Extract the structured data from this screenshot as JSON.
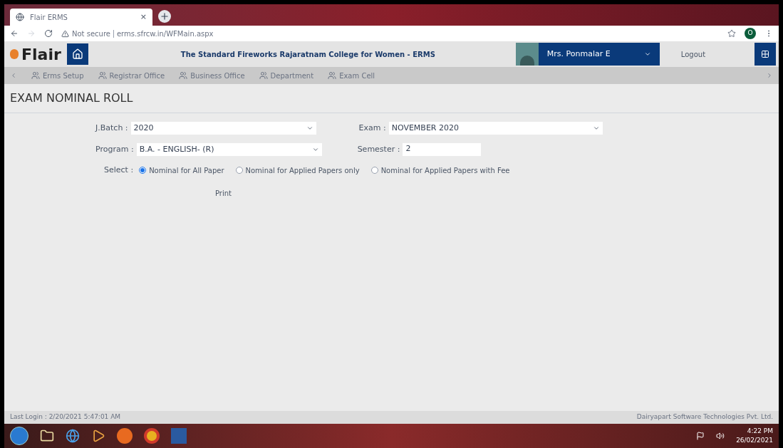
{
  "browser": {
    "tab_title": "Flair ERMS",
    "tab_close": "×",
    "address_warning": "Not secure",
    "url": "erms.sfrcw.in/WFMain.aspx",
    "profile_initial": "O"
  },
  "header": {
    "logo": "Flair",
    "college": "The Standard Fireworks Rajaratnam College for Women - ERMS",
    "user": "Mrs. Ponmalar E",
    "logout": "Logout"
  },
  "nav": [
    {
      "label": "Erms Setup"
    },
    {
      "label": "Registrar Office"
    },
    {
      "label": "Business Office"
    },
    {
      "label": "Department"
    },
    {
      "label": "Exam Cell"
    }
  ],
  "page_title": "EXAM NOMINAL ROLL",
  "form": {
    "batch": {
      "label": "J.Batch :",
      "value": "2020"
    },
    "exam": {
      "label": "Exam :",
      "value": "NOVEMBER 2020"
    },
    "program": {
      "label": "Program :",
      "value": "B.A. - ENGLISH- (R)"
    },
    "semester": {
      "label": "Semester :",
      "value": "2"
    },
    "select_label": "Select :",
    "options": [
      {
        "label": "Nominal for All Paper",
        "selected": true
      },
      {
        "label": "Nominal for Applied Papers only",
        "selected": false
      },
      {
        "label": "Nominal for Applied Papers with Fee",
        "selected": false
      }
    ],
    "print": "Print"
  },
  "footer": {
    "last_login": "Last Login : 2/20/2021 5:47:01 AM",
    "company": "Dairyapart Software Technologies Pvt. Ltd."
  },
  "taskbar": {
    "time": "4:22 PM",
    "date": "26/02/2021"
  }
}
